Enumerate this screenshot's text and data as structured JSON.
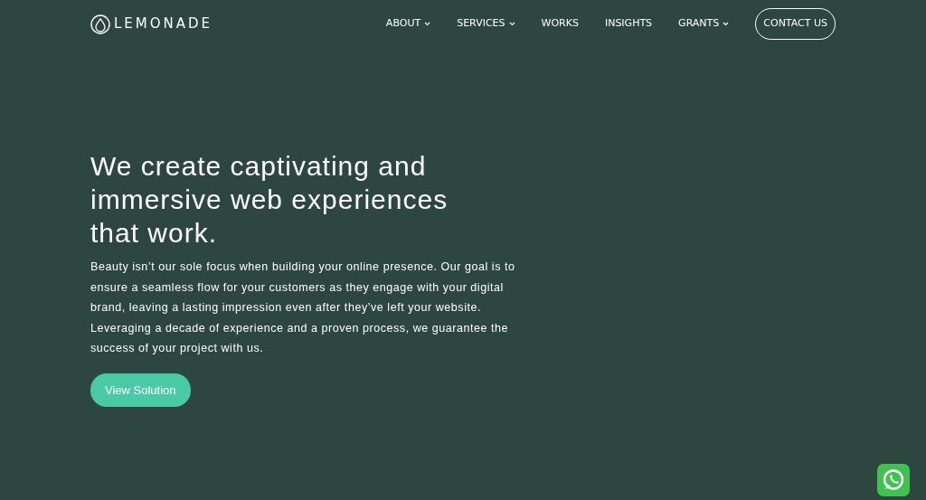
{
  "logo": {
    "text": "LEMONADE"
  },
  "nav": [
    {
      "label": "ABOUT",
      "dropdown": true
    },
    {
      "label": "SERVICES",
      "dropdown": true
    },
    {
      "label": "WORKS",
      "dropdown": false
    },
    {
      "label": "INSIGHTS",
      "dropdown": false
    },
    {
      "label": "GRANTS",
      "dropdown": true
    }
  ],
  "contact_button": "CONTACT US",
  "hero": {
    "heading": "We create captivating and immersive web experiences that work.",
    "body": "Beauty isn’t our sole focus when building your online presence. Our goal is to ensure a seamless flow for your customers as they engage with your digital brand, leaving a lasting impression even after they’ve left your website. Leveraging a decade of experience and a proven process, we guarantee the success of your project with us.",
    "button": "View Solution"
  }
}
